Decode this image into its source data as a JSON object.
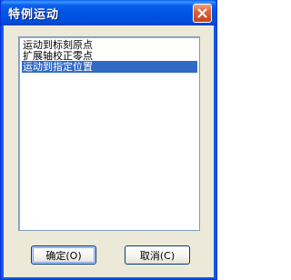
{
  "dialog": {
    "title": "特例运动",
    "close_symbol": "×"
  },
  "list": {
    "items": [
      {
        "label": "运动到标刻原点",
        "selected": false
      },
      {
        "label": "扩展轴校正零点",
        "selected": false
      },
      {
        "label": "运动到指定位置",
        "selected": true
      }
    ]
  },
  "buttons": {
    "ok_label": "确定(O)",
    "cancel_label": "取消(C)"
  },
  "colors": {
    "titlebar": "#0054e3",
    "selection": "#316ac5",
    "face": "#ece9d8"
  }
}
